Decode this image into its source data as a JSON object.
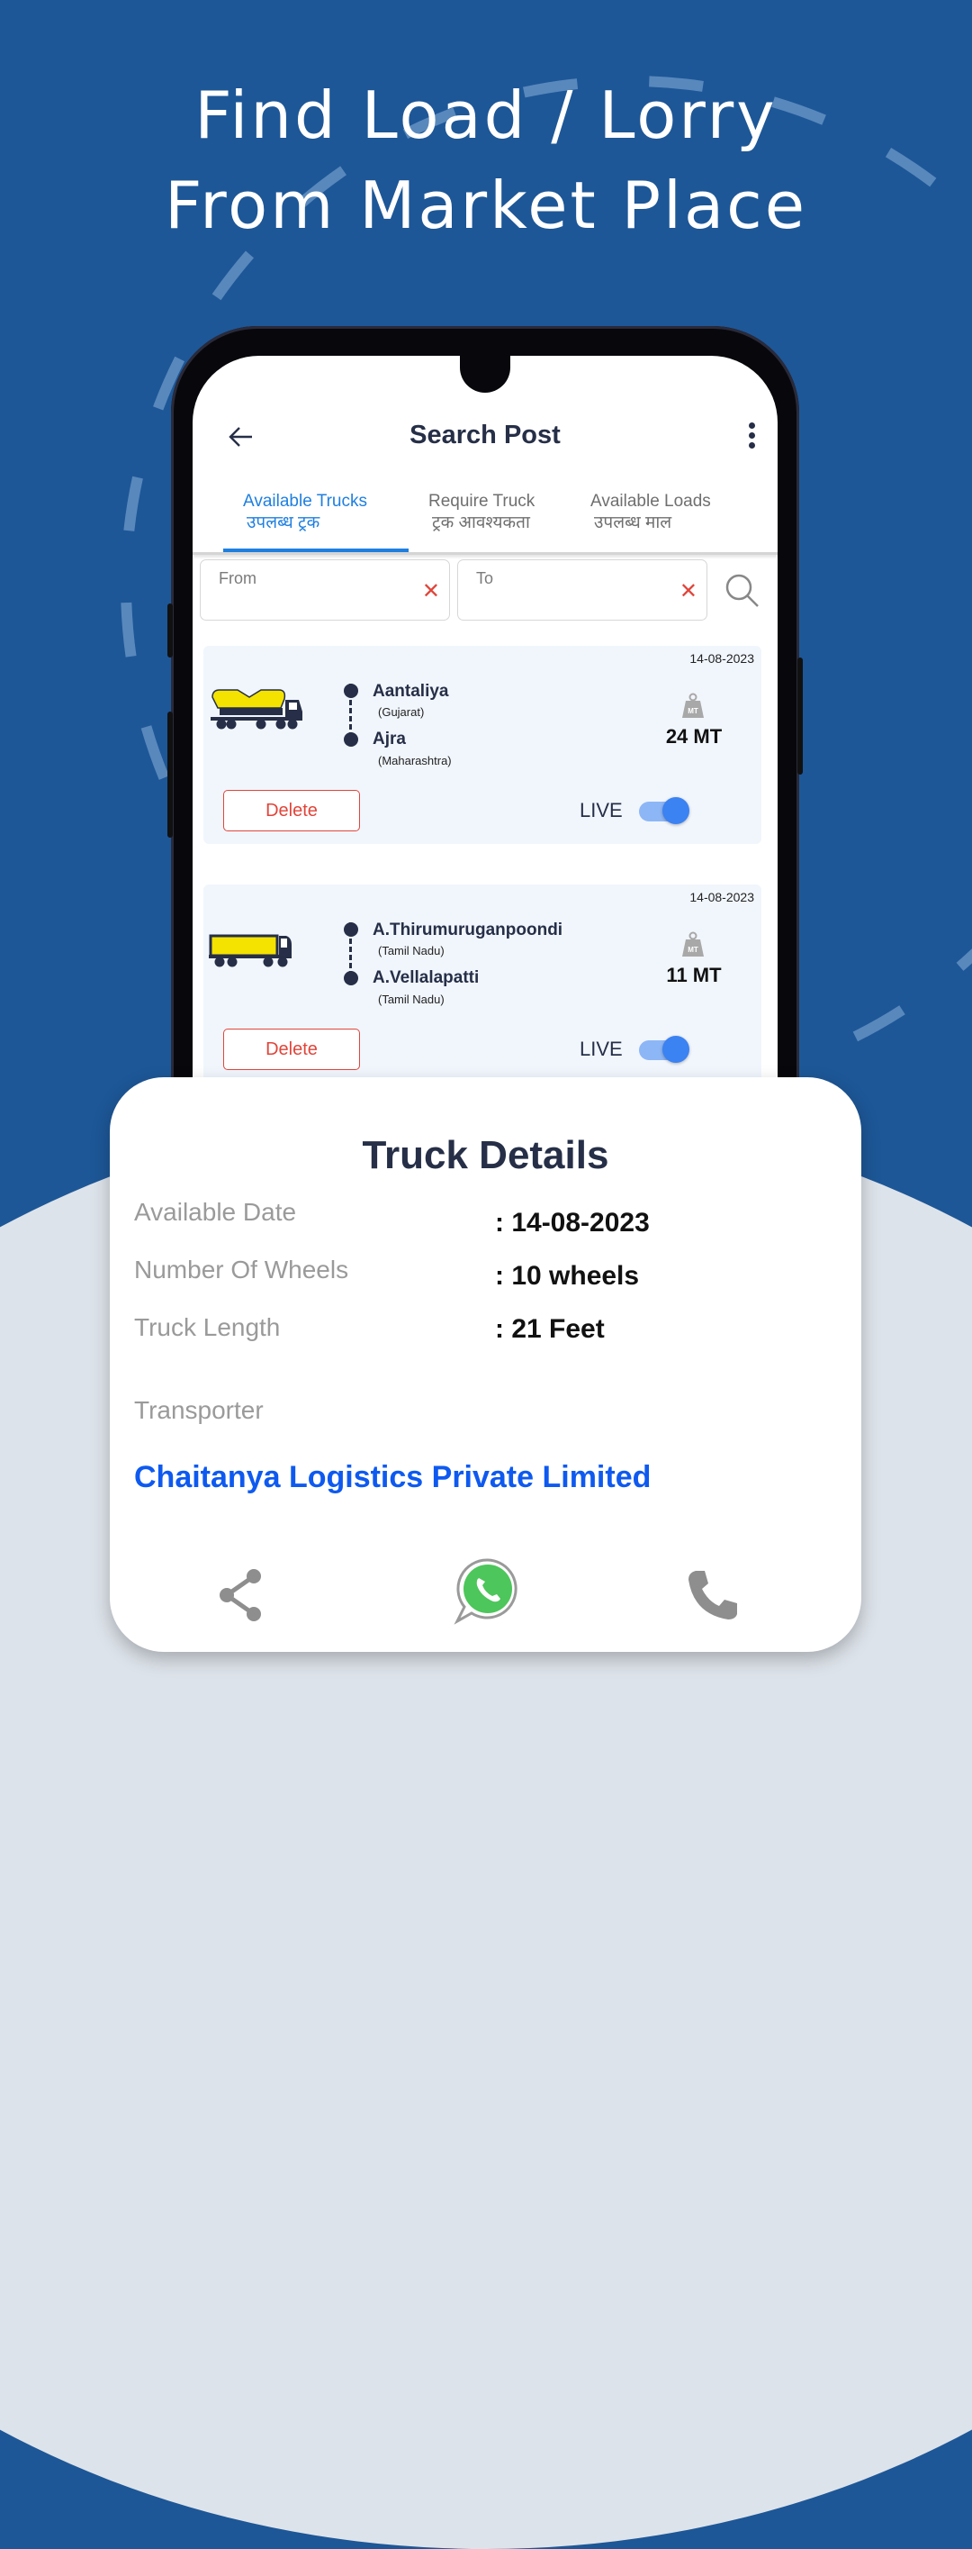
{
  "headline": {
    "line1": "Find Load / Lorry",
    "line2": "From Market Place"
  },
  "app": {
    "title": "Search Post",
    "icons": {
      "back": "arrow-left-icon",
      "menu": "more-vertical-icon",
      "search": "search-icon"
    },
    "tabs": [
      {
        "label": "Available Trucks",
        "label_hi": "उपलब्ध ट्रक",
        "active": true
      },
      {
        "label": "Require Truck",
        "label_hi": "ट्रक आवश्यकता",
        "active": false
      },
      {
        "label": "Available Loads",
        "label_hi": "उपलब्ध माल",
        "active": false
      }
    ],
    "search": {
      "from": {
        "placeholder": "From",
        "value": "",
        "clear": "✕"
      },
      "to": {
        "placeholder": "To",
        "value": "",
        "clear": "✕"
      }
    },
    "posts": [
      {
        "date": "14-08-2023",
        "truck_icon": "tanker-truck-icon",
        "from_city": "Aantaliya",
        "from_state": "(Gujarat)",
        "to_city": "Ajra",
        "to_state": "(Maharashtra)",
        "weight_badge": "MT",
        "weight": "24 MT",
        "delete_label": "Delete",
        "status_label": "LIVE",
        "live": true
      },
      {
        "date": "14-08-2023",
        "truck_icon": "container-truck-icon",
        "from_city": "A.Thirumuruganpoondi",
        "from_state": "(Tamil Nadu)",
        "to_city": "A.Vellalapatti",
        "to_state": "(Tamil Nadu)",
        "weight_badge": "MT",
        "weight": "11 MT",
        "delete_label": "Delete",
        "status_label": "LIVE",
        "live": true
      }
    ]
  },
  "details": {
    "title": "Truck Details",
    "rows": [
      {
        "label": "Available Date",
        "value": ": 14-08-2023"
      },
      {
        "label": "Number Of Wheels",
        "value": ": 10 wheels"
      },
      {
        "label": "Truck Length",
        "value": ": 21 Feet"
      }
    ],
    "transporter_label": "Transporter",
    "transporter_name": "Chaitanya Logistics Private Limited",
    "actions": [
      "share-icon",
      "whatsapp-icon",
      "phone-icon"
    ]
  },
  "colors": {
    "background": "#1d5797",
    "accent": "#1f7fe0",
    "danger": "#e0453a",
    "link": "#0e5af0",
    "toggle_on": "#3b82f3"
  }
}
